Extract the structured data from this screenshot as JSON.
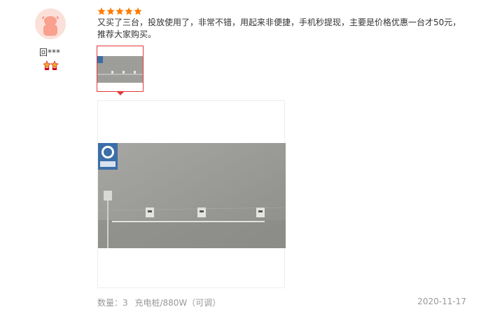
{
  "review": {
    "username": "回***",
    "rating": 5,
    "text": "又买了三台，投放使用了，非常不错，用起来非便捷，手机秒提现，主要是价格优惠一台才50元，推荐大家购买。",
    "meta": {
      "quantity": "数量：3",
      "product": "充电桩/880W（可调）"
    },
    "date": "2020-11-17"
  },
  "colors": {
    "star": "#ff7c00",
    "thumb_border": "#e4393c",
    "avatar_bg": "#fbe0da",
    "avatar_icon": "#f9a08e",
    "meta_text": "#999999"
  },
  "icons": {
    "star": "star-icon",
    "avatar": "avatar-cow-icon",
    "badge": "member-level-badge-icon"
  }
}
